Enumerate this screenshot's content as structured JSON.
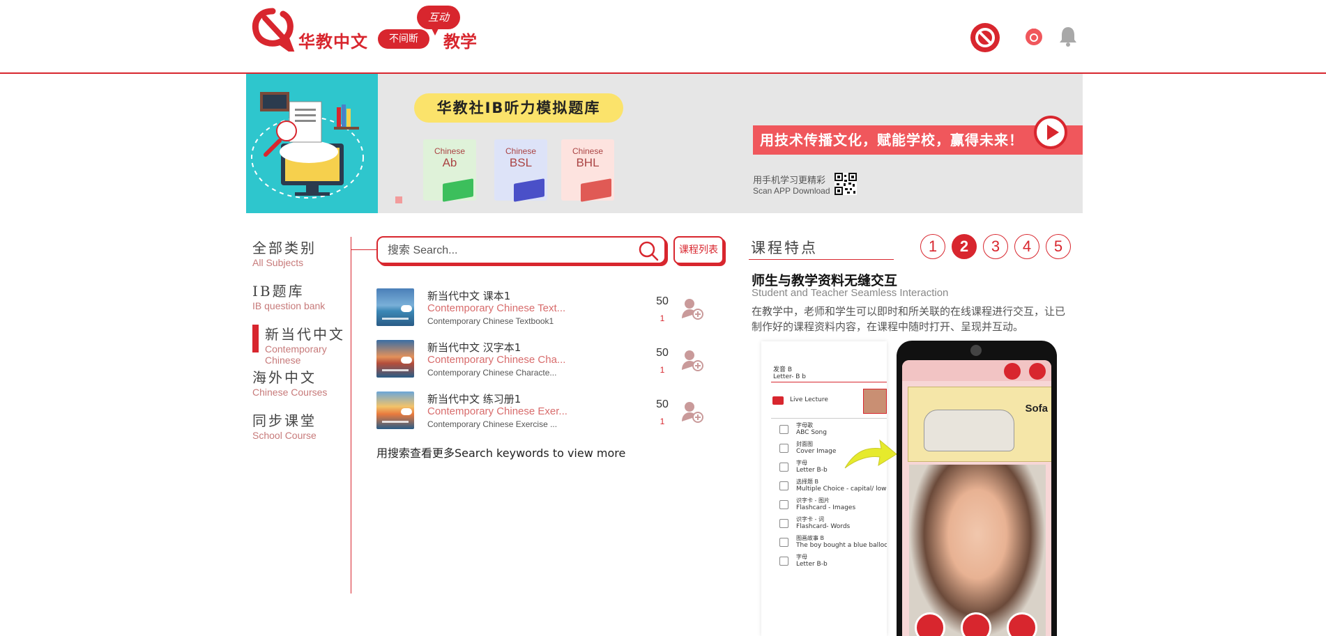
{
  "header": {
    "logo_title": "华教中文",
    "logo_pill": "不间断",
    "logo_bubble": "互动",
    "logo_teach": "教学"
  },
  "banner": {
    "pill": "华教社IB听力模拟题库",
    "books": [
      {
        "lang": "Chinese",
        "code": "Ab",
        "bg": "#dff2d9",
        "cover": "#3cbf5c"
      },
      {
        "lang": "Chinese",
        "code": "BSL",
        "bg": "#dde3f8",
        "cover": "#4a50c8"
      },
      {
        "lang": "Chinese",
        "code": "BHL",
        "bg": "#fde3df",
        "cover": "#e05a55"
      }
    ],
    "slogan": "用技术传播文化，赋能学校，赢得未来！",
    "app_line1": "用手机学习更精彩",
    "app_line2": "Scan APP Download"
  },
  "nav": {
    "items": [
      {
        "zh": "全部类别",
        "en": "All Subjects"
      },
      {
        "zh": "IB题库",
        "en": "IB question bank"
      },
      {
        "zh": "新当代中文",
        "en": "Contemporary Chinese"
      },
      {
        "zh": "海外中文",
        "en": "Chinese Courses"
      },
      {
        "zh": "同步课堂",
        "en": "School Course"
      }
    ]
  },
  "search": {
    "placeholder": "搜索 Search...",
    "list_button": "课程列表"
  },
  "results": [
    {
      "title": "新当代中文 课本1",
      "sub": "Contemporary Chinese Text...",
      "sub2": "Contemporary Chinese Textbook1",
      "count": "50",
      "num": "1"
    },
    {
      "title": "新当代中文 汉字本1",
      "sub": "Contemporary Chinese Cha...",
      "sub2": "Contemporary Chinese Characte...",
      "count": "50",
      "num": "1"
    },
    {
      "title": "新当代中文 练习册1",
      "sub": "Contemporary Chinese Exer...",
      "sub2": "Contemporary Chinese Exercise ...",
      "count": "50",
      "num": "1"
    }
  ],
  "more_text": "用搜索查看更多Search keywords to view more",
  "features": {
    "title": "课程特点",
    "pages": [
      "1",
      "2",
      "3",
      "4",
      "5"
    ],
    "active_page": "2",
    "heading": "师生与教学资料无缝交互",
    "subheading": "Student and Teacher Seamless Interaction",
    "description": "在教学中，老师和学生可以即时和所关联的在线课程进行交互，让已制作好的课程资料内容，在课程中随时打开、呈现并互动。"
  },
  "mockup": {
    "header_zh": "发音 B",
    "header_en": "Letter- B b",
    "live_lecture": "Live Lecture",
    "items": [
      {
        "zh": "字母歌",
        "en": "ABC Song"
      },
      {
        "zh": "封面图",
        "en": "Cover Image"
      },
      {
        "zh": "字母",
        "en": "Letter B-b"
      },
      {
        "zh": "选择题 B",
        "en": "Multiple Choice - capital/ lower case"
      },
      {
        "zh": "识字卡 - 图片",
        "en": "Flashcard - Images"
      },
      {
        "zh": "识字卡 - 词",
        "en": "Flashcard- Words"
      },
      {
        "zh": "图画故事 B",
        "en": "The boy bought a blue balloon."
      },
      {
        "zh": "字母",
        "en": "Letter B-b"
      }
    ],
    "scene_label": "Sofa"
  },
  "colors": {
    "accent": "#d8262e",
    "banner_teal": "#2ec6cd",
    "banner_bg": "#e6e6e6",
    "pill_yellow": "#fbe36b"
  }
}
